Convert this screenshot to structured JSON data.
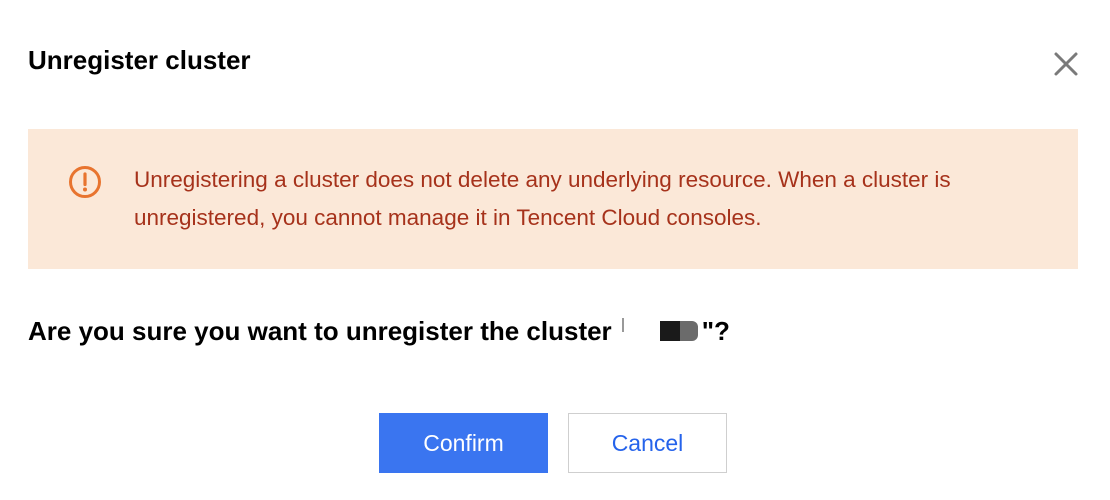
{
  "dialog": {
    "title": "Unregister cluster",
    "close_icon": "close-icon"
  },
  "alert": {
    "icon": "warning-circle-icon",
    "text": "Unregistering a cluster does not delete any underlying resource. When a cluster is unregistered, you cannot manage it in Tencent Cloud consoles.",
    "background": "#fbe8d8",
    "text_color": "#a6321b",
    "icon_color": "#e8742f"
  },
  "question": {
    "prefix": "Are you sure you want to unregister the cluster",
    "suffix": "\"?"
  },
  "buttons": {
    "confirm_label": "Confirm",
    "cancel_label": "Cancel",
    "confirm_color": "#3a75f0"
  }
}
